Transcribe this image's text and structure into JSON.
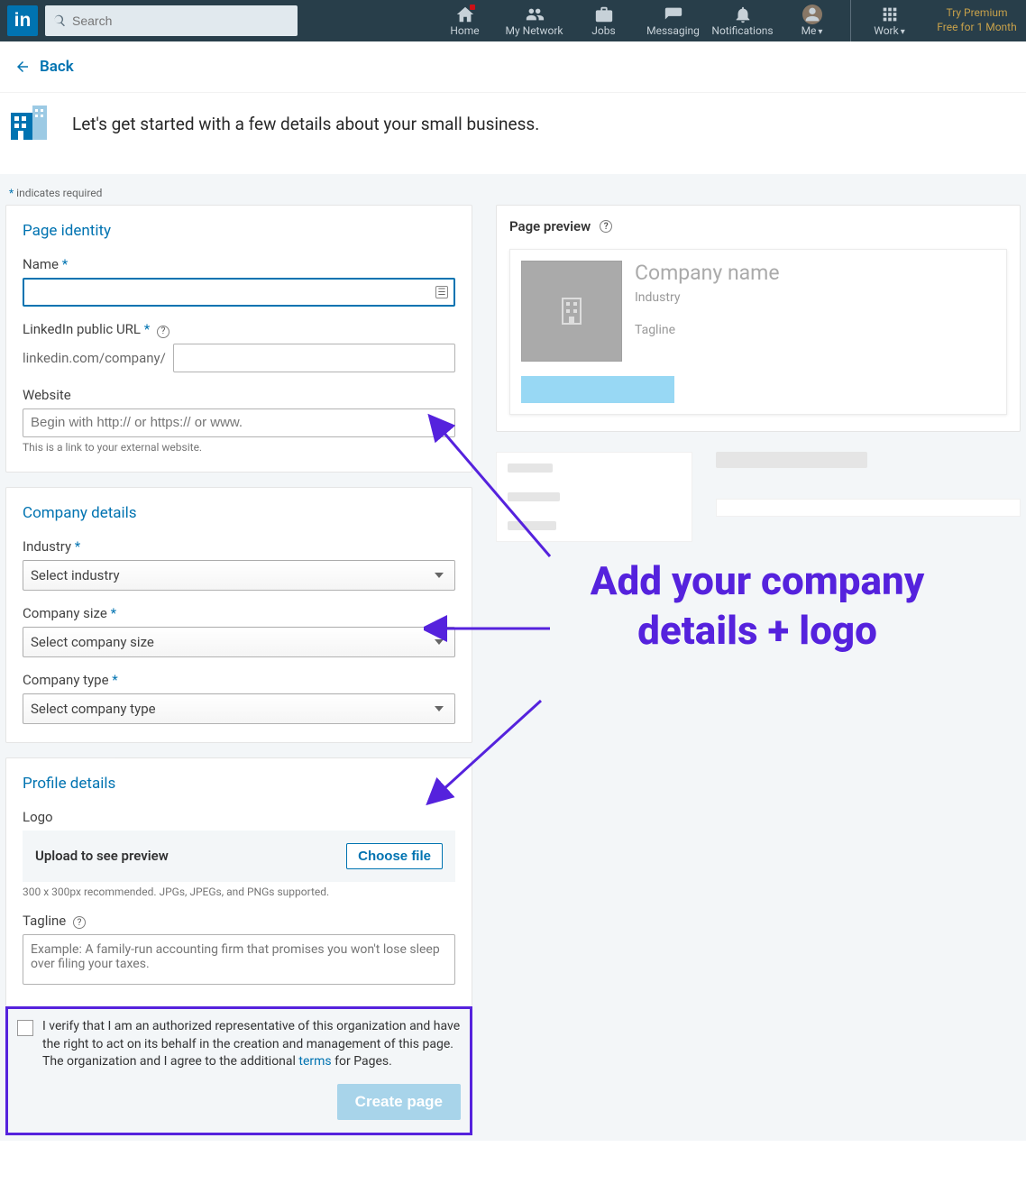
{
  "nav": {
    "search_placeholder": "Search",
    "home": "Home",
    "network": "My Network",
    "jobs": "Jobs",
    "messaging": "Messaging",
    "notifications": "Notifications",
    "me": "Me",
    "work": "Work",
    "premium_line1": "Try Premium",
    "premium_line2": "Free for 1 Month"
  },
  "back": {
    "label": "Back"
  },
  "intro": {
    "headline": "Let's get started with a few details about your small business."
  },
  "required_note": "indicates required",
  "identity": {
    "title": "Page identity",
    "name_label": "Name",
    "url_label": "LinkedIn public URL",
    "url_prefix": "linkedin.com/company/",
    "website_label": "Website",
    "website_placeholder": "Begin with http:// or https:// or www.",
    "website_help": "This is a link to your external website."
  },
  "company": {
    "title": "Company details",
    "industry_label": "Industry",
    "industry_placeholder": "Select industry",
    "size_label": "Company size",
    "size_placeholder": "Select company size",
    "type_label": "Company type",
    "type_placeholder": "Select company type"
  },
  "profile": {
    "title": "Profile details",
    "logo_label": "Logo",
    "upload_text": "Upload to see preview",
    "choose_file": "Choose file",
    "logo_help": "300 x 300px recommended. JPGs, JPEGs, and PNGs supported.",
    "tagline_label": "Tagline",
    "tagline_placeholder": "Example: A family-run accounting firm that promises you won't lose sleep over filing your taxes."
  },
  "verify": {
    "text_1": "I verify that I am an authorized representative of this organization and have the right to act on its behalf in the creation and management of this page. The organization and I agree to the additional ",
    "terms": "terms",
    "text_2": " for Pages.",
    "button": "Create page"
  },
  "preview": {
    "title": "Page preview",
    "company_name": "Company name",
    "industry": "Industry",
    "tagline": "Tagline"
  },
  "annotation": {
    "text": "Add your company details + logo"
  }
}
